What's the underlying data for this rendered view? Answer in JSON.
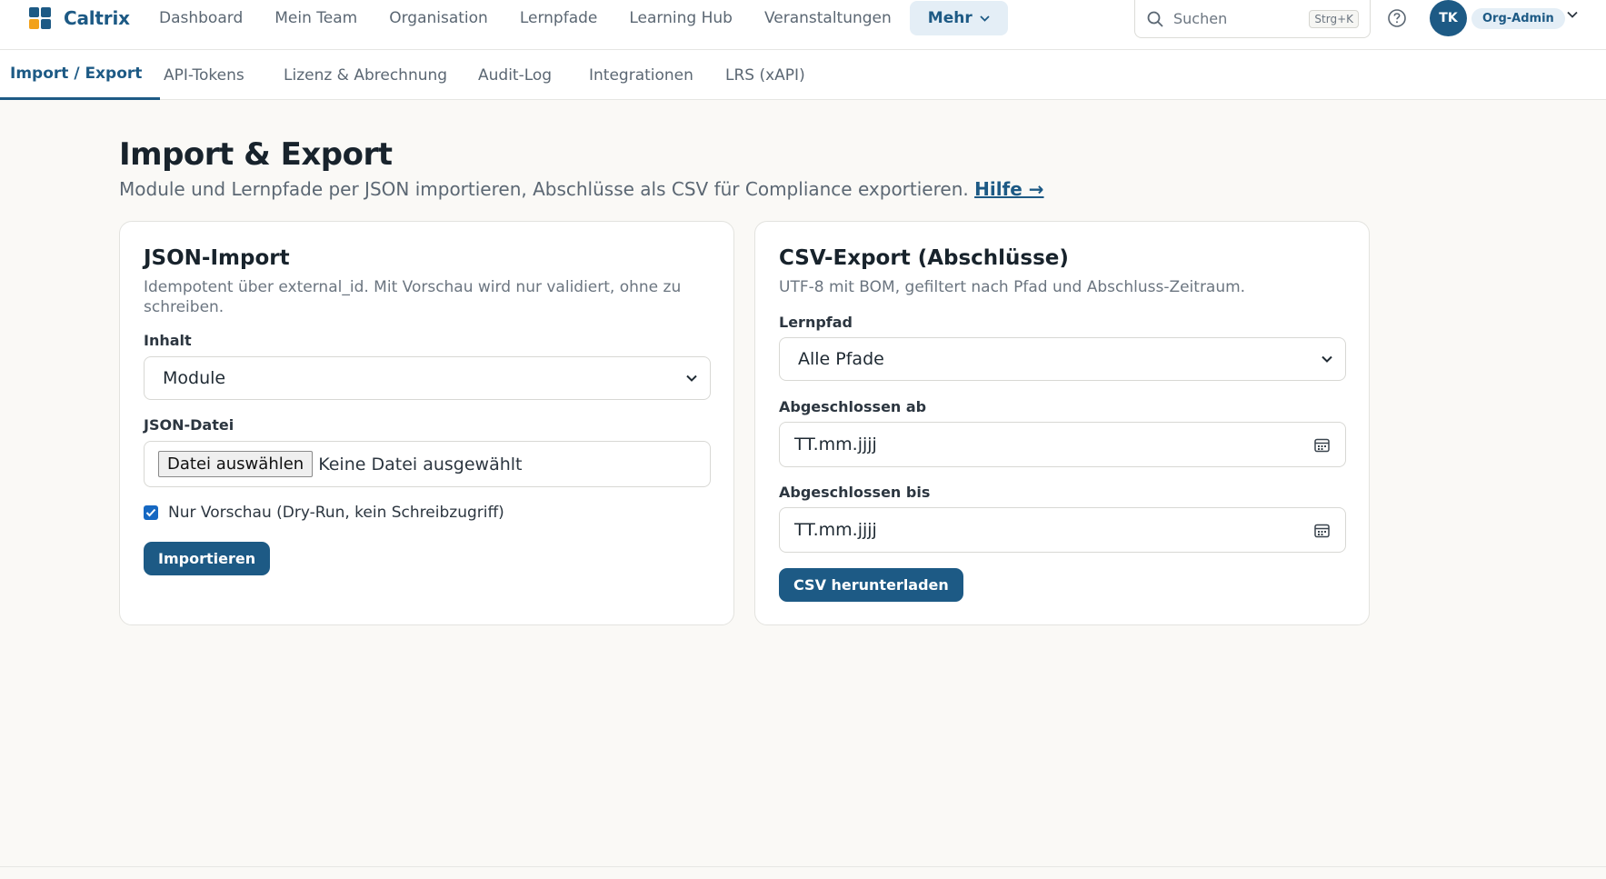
{
  "brand": {
    "name": "Caltrix",
    "logo_colors": [
      "#1d5a85",
      "#1d5a85",
      "#f2a21b",
      "#1d5a85"
    ]
  },
  "nav": {
    "items": [
      "Dashboard",
      "Mein Team",
      "Organisation",
      "Lernpfade",
      "Learning Hub",
      "Veranstaltungen"
    ],
    "more_label": "Mehr"
  },
  "search": {
    "placeholder": "Suchen",
    "shortcut": "Strg+K"
  },
  "user": {
    "initials": "TK",
    "role": "Org-Admin"
  },
  "subnav": {
    "tabs": [
      "Import / Export",
      "API-Tokens",
      "Lizenz & Abrechnung",
      "Audit-Log",
      "Integrationen",
      "LRS (xAPI)"
    ],
    "active": "Import / Export"
  },
  "page": {
    "title": "Import & Export",
    "subtitle": "Module und Lernpfade per JSON importieren, Abschlüsse als CSV für Compliance exportieren.",
    "help_link": "Hilfe →"
  },
  "import_card": {
    "title": "JSON-Import",
    "description": "Idempotent über external_id. Mit Vorschau wird nur validiert, ohne zu schreiben.",
    "content_label": "Inhalt",
    "content_value": "Module",
    "file_label": "JSON-Datei",
    "file_button": "Datei auswählen",
    "file_status": "Keine Datei ausgewählt",
    "dry_run_label": "Nur Vorschau (Dry-Run, kein Schreibzugriff)",
    "dry_run_checked": true,
    "submit_label": "Importieren"
  },
  "export_card": {
    "title": "CSV-Export (Abschlüsse)",
    "description": "UTF-8 mit BOM, gefiltert nach Pfad und Abschluss-Zeitraum.",
    "path_label": "Lernpfad",
    "path_value": "Alle Pfade",
    "from_label": "Abgeschlossen ab",
    "from_placeholder": "TT.mm.jjjj",
    "to_label": "Abgeschlossen bis",
    "to_placeholder": "TT.mm.jjjj",
    "submit_label": "CSV herunterladen"
  }
}
